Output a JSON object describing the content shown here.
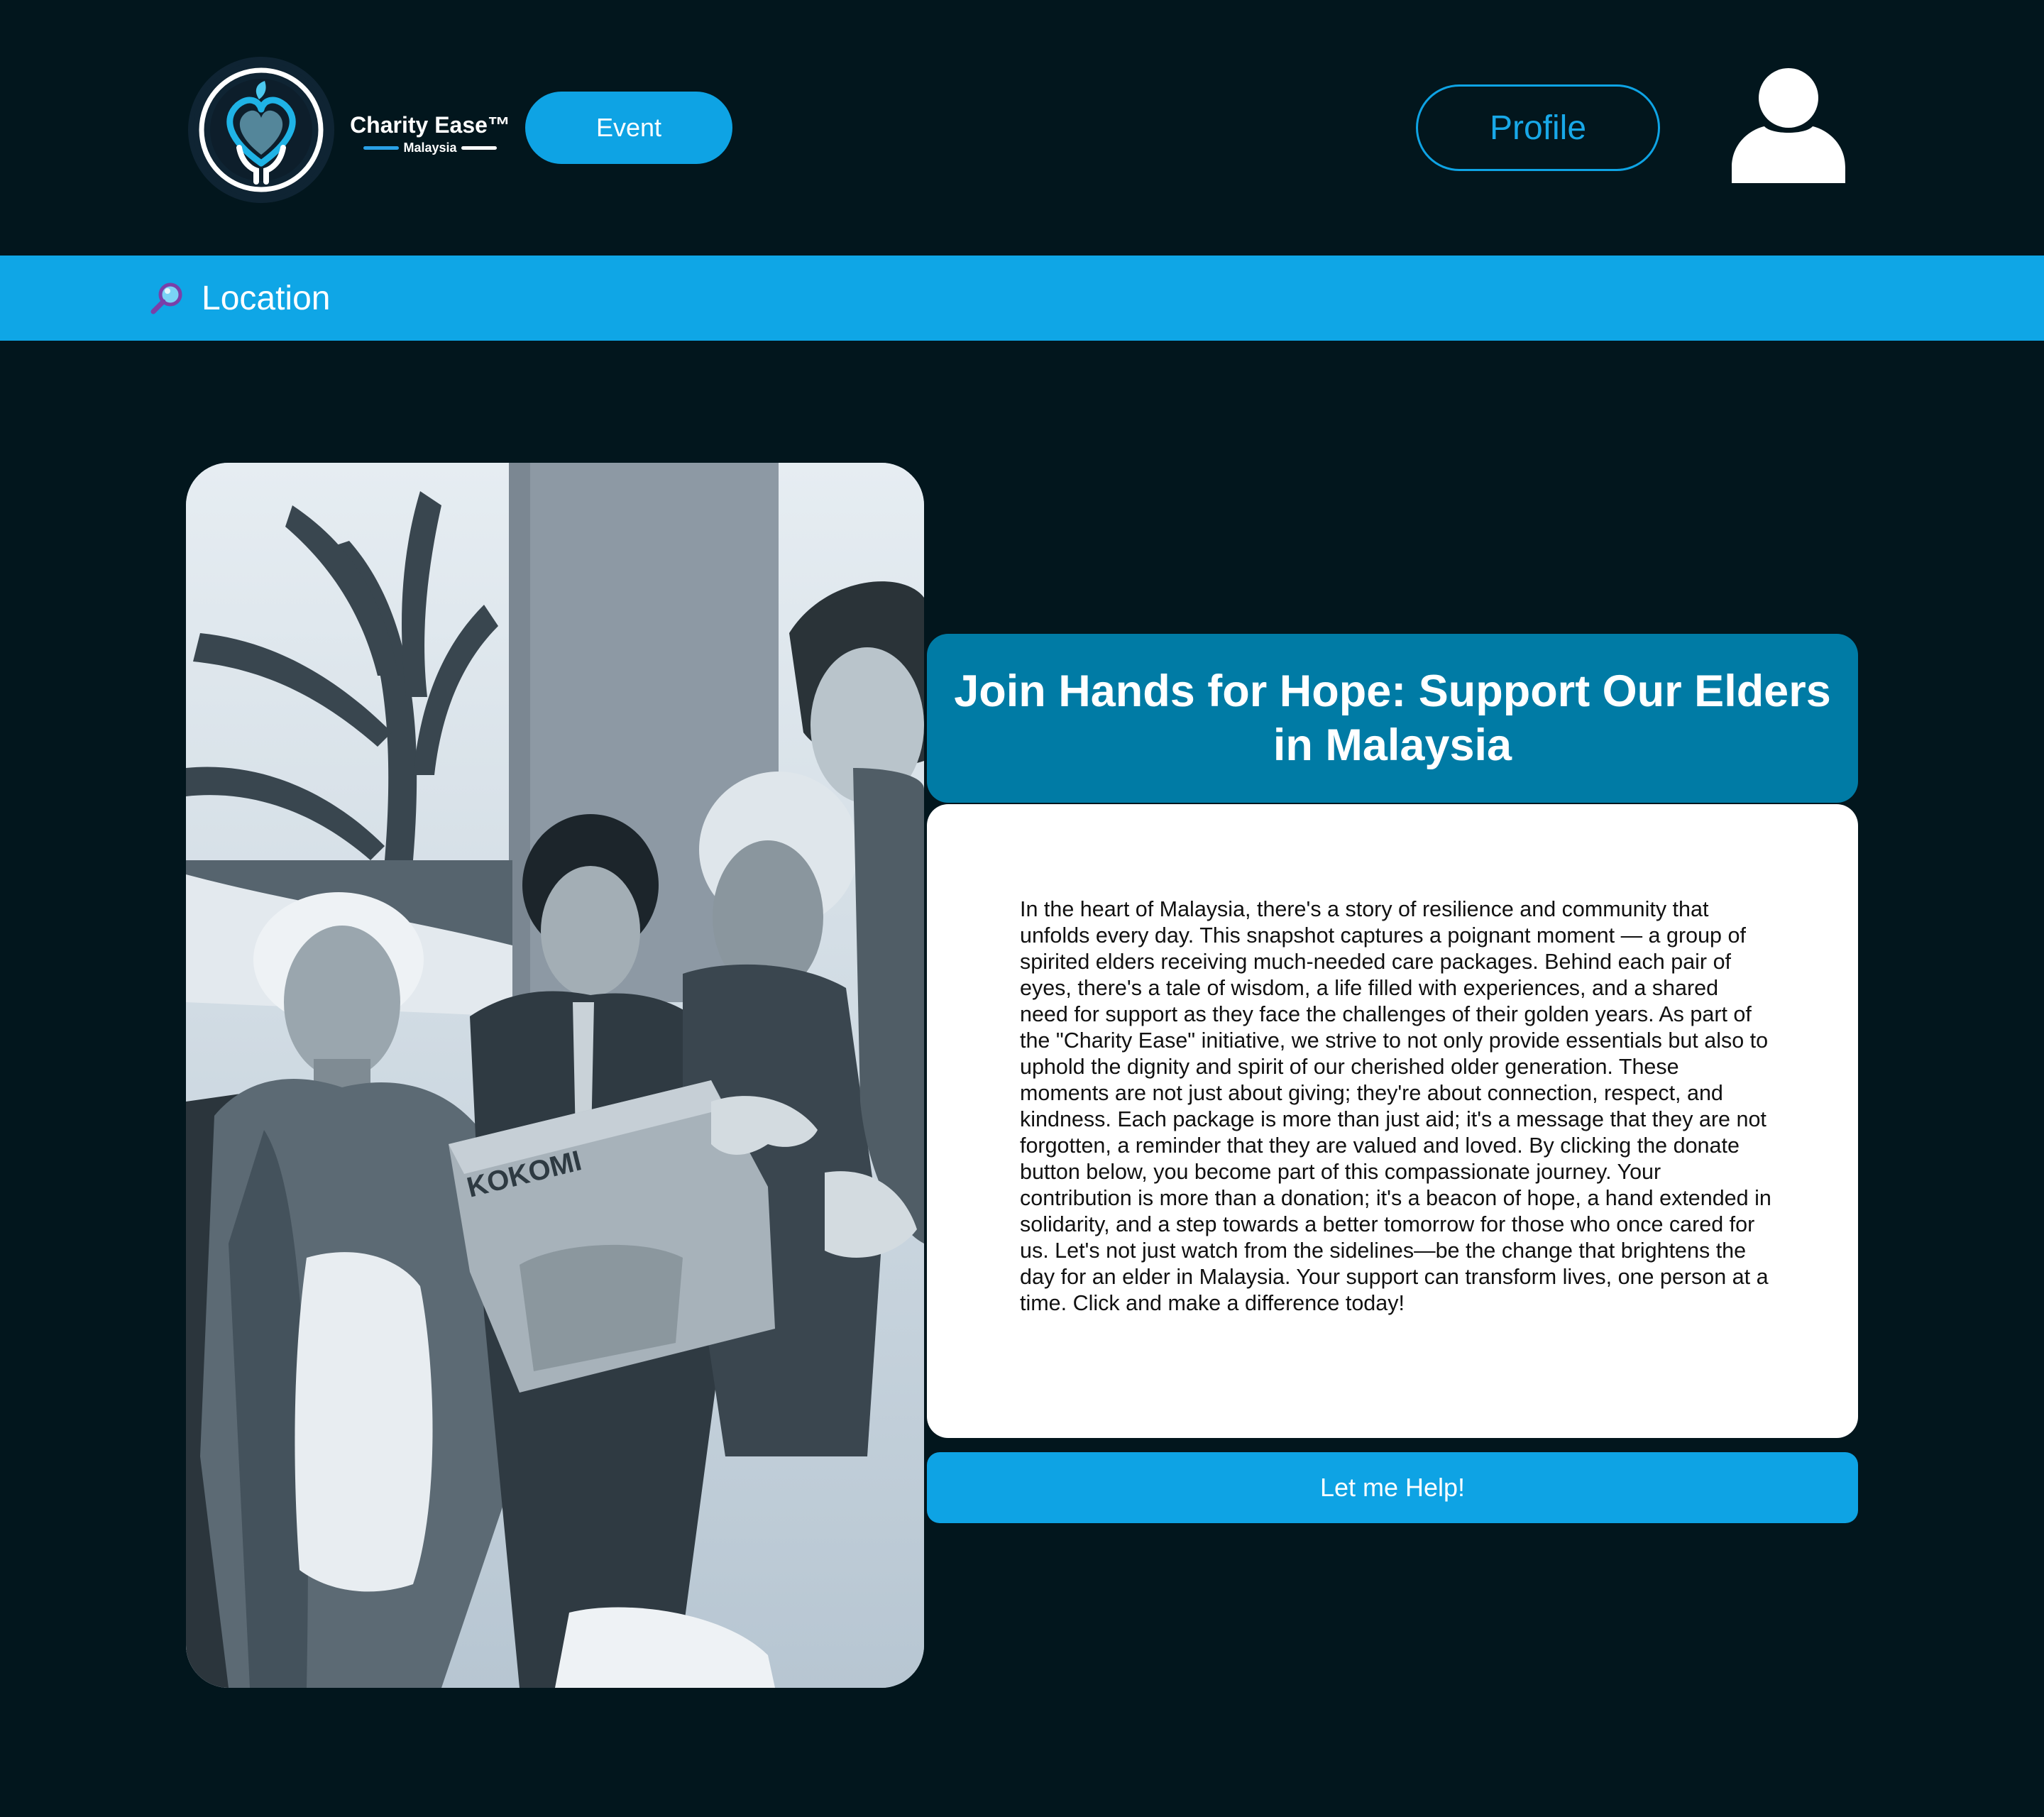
{
  "header": {
    "brand_name": "Charity Ease™",
    "brand_country": "Malaysia",
    "logo_icon": "heart-hands-logo-icon",
    "event_label": "Event",
    "profile_label": "Profile",
    "avatar_icon": "user-icon"
  },
  "location_bar": {
    "icon": "search-icon",
    "label": "Location"
  },
  "campaign": {
    "image": "elders-receiving-care-packages-photo",
    "title": "Join Hands for Hope: Support Our Elders in Malaysia",
    "description": "In the heart of Malaysia, there's a story of resilience and community that unfolds every day. This snapshot captures a poignant moment — a group of spirited elders receiving much-needed care packages. Behind each pair of eyes, there's a tale of wisdom, a life filled with experiences, and a shared need for support as they face the challenges of their golden years. As part of the \"Charity Ease\" initiative, we strive to not only provide essentials but also to uphold the dignity and spirit of our cherished older generation. These moments are not just about giving; they're about connection, respect, and kindness. Each package is more than just aid; it's a message that they are not forgotten, a reminder that they are valued and loved. By clicking the donate button below, you become part of this compassionate journey. Your contribution is more than a donation; it's a beacon of hope, a hand extended in solidarity, and a step towards a better tomorrow for those who once cared for us. Let's not just watch from the sidelines—be the change that brightens the day for an elder in Malaysia. Your support can transform lives, one person at a time. Click and make a difference today!",
    "cta_label": "Let me Help!",
    "box_label": "KOKOMI"
  },
  "colors": {
    "page_bg": "#02161d",
    "accent": "#0ea3e4",
    "title_bg": "#007ba5",
    "card_bg": "#ffffff"
  }
}
